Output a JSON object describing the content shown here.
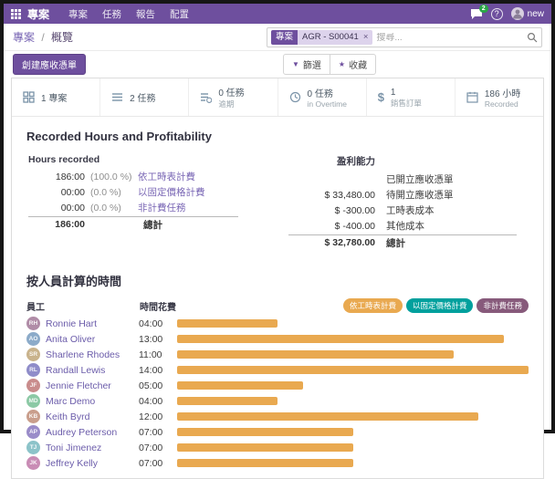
{
  "colors": {
    "topbar": "#6e4f9e",
    "accent": "#6e4f9e",
    "link": "#6b5caa",
    "bar_orange": "#e9a950",
    "badge_teal": "#00a09d",
    "badge_purple": "#875a7b",
    "notification_green": "#28a745"
  },
  "topbar": {
    "app_title": "專案",
    "menu": [
      "專案",
      "任務",
      "報告",
      "配置"
    ],
    "notification_count": "2",
    "help": "?",
    "user_name": "new"
  },
  "control_panel": {
    "breadcrumb_parent": "專案",
    "breadcrumb_separator": "/",
    "breadcrumb_current": "概覽",
    "search_facet_field": "專案",
    "search_facet_value": "AGR - S00041",
    "search_facet_remove": "×",
    "search_placeholder": "搜尋...",
    "create_button": "創建應收憑單",
    "filters_button": "篩選",
    "favorites_button": "收藏",
    "filters_icon_glyph": "▼",
    "favorites_icon_glyph": "★"
  },
  "stats": [
    {
      "icon": "project-icon",
      "line1": "1 專案",
      "line2": ""
    },
    {
      "icon": "tasks-icon",
      "line1": "2 任務",
      "line2": ""
    },
    {
      "icon": "late-tasks-icon",
      "line1": "0 任務",
      "line2": "逾期"
    },
    {
      "icon": "overtime-icon",
      "line1": "0 任務",
      "line2": "in Overtime"
    },
    {
      "icon": "dollar-icon",
      "glyph": "$",
      "line1": "1",
      "line2": "銷售訂單"
    },
    {
      "icon": "calendar-icon",
      "line1": "186 小時",
      "line2": "Recorded"
    }
  ],
  "overview": {
    "title": "Recorded Hours and Profitability",
    "hours": {
      "title": "Hours recorded",
      "rows": [
        {
          "value": "186:00",
          "pct": "(100.0 %)",
          "label": "依工時表計費"
        },
        {
          "value": "00:00",
          "pct": "(0.0 %)",
          "label": "以固定價格計費"
        },
        {
          "value": "00:00",
          "pct": "(0.0 %)",
          "label": "非計費任務"
        }
      ],
      "total_value": "186:00",
      "total_label": "總計"
    },
    "profitability": {
      "title": "盈利能力",
      "rows": [
        {
          "value": "",
          "label": "已開立應收憑單"
        },
        {
          "value": "$ 33,480.00",
          "label": "待開立應收憑單"
        },
        {
          "value": "$ -300.00",
          "label": "工時表成本"
        },
        {
          "value": "$ -400.00",
          "label": "其他成本"
        }
      ],
      "total_value": "$ 32,780.00",
      "total_label": "總計"
    }
  },
  "people": {
    "title": "按人員計算的時間",
    "col_employee": "員工",
    "col_time": "時間花費",
    "legend": [
      {
        "label": "依工時表計費",
        "color": "#e9a950"
      },
      {
        "label": "以固定價格計費",
        "color": "#00a09d"
      },
      {
        "label": "非計費任務",
        "color": "#875a7b"
      }
    ],
    "max_hours": 14,
    "avatar_colors": [
      "#b08ca7",
      "#8cabc9",
      "#c9b38c",
      "#8f8cc9",
      "#c98c8c",
      "#8cc9a5",
      "#c99e8c",
      "#9a8cc9",
      "#8cc3c9",
      "#c98cb5"
    ],
    "rows": [
      {
        "name": "Ronnie Hart",
        "time": "04:00",
        "hours": 4
      },
      {
        "name": "Anita Oliver",
        "time": "13:00",
        "hours": 13
      },
      {
        "name": "Sharlene Rhodes",
        "time": "11:00",
        "hours": 11
      },
      {
        "name": "Randall Lewis",
        "time": "14:00",
        "hours": 14
      },
      {
        "name": "Jennie Fletcher",
        "time": "05:00",
        "hours": 5
      },
      {
        "name": "Marc Demo",
        "time": "04:00",
        "hours": 4
      },
      {
        "name": "Keith Byrd",
        "time": "12:00",
        "hours": 12
      },
      {
        "name": "Audrey Peterson",
        "time": "07:00",
        "hours": 7
      },
      {
        "name": "Toni Jimenez",
        "time": "07:00",
        "hours": 7
      },
      {
        "name": "Jeffrey Kelly",
        "time": "07:00",
        "hours": 7
      }
    ]
  }
}
